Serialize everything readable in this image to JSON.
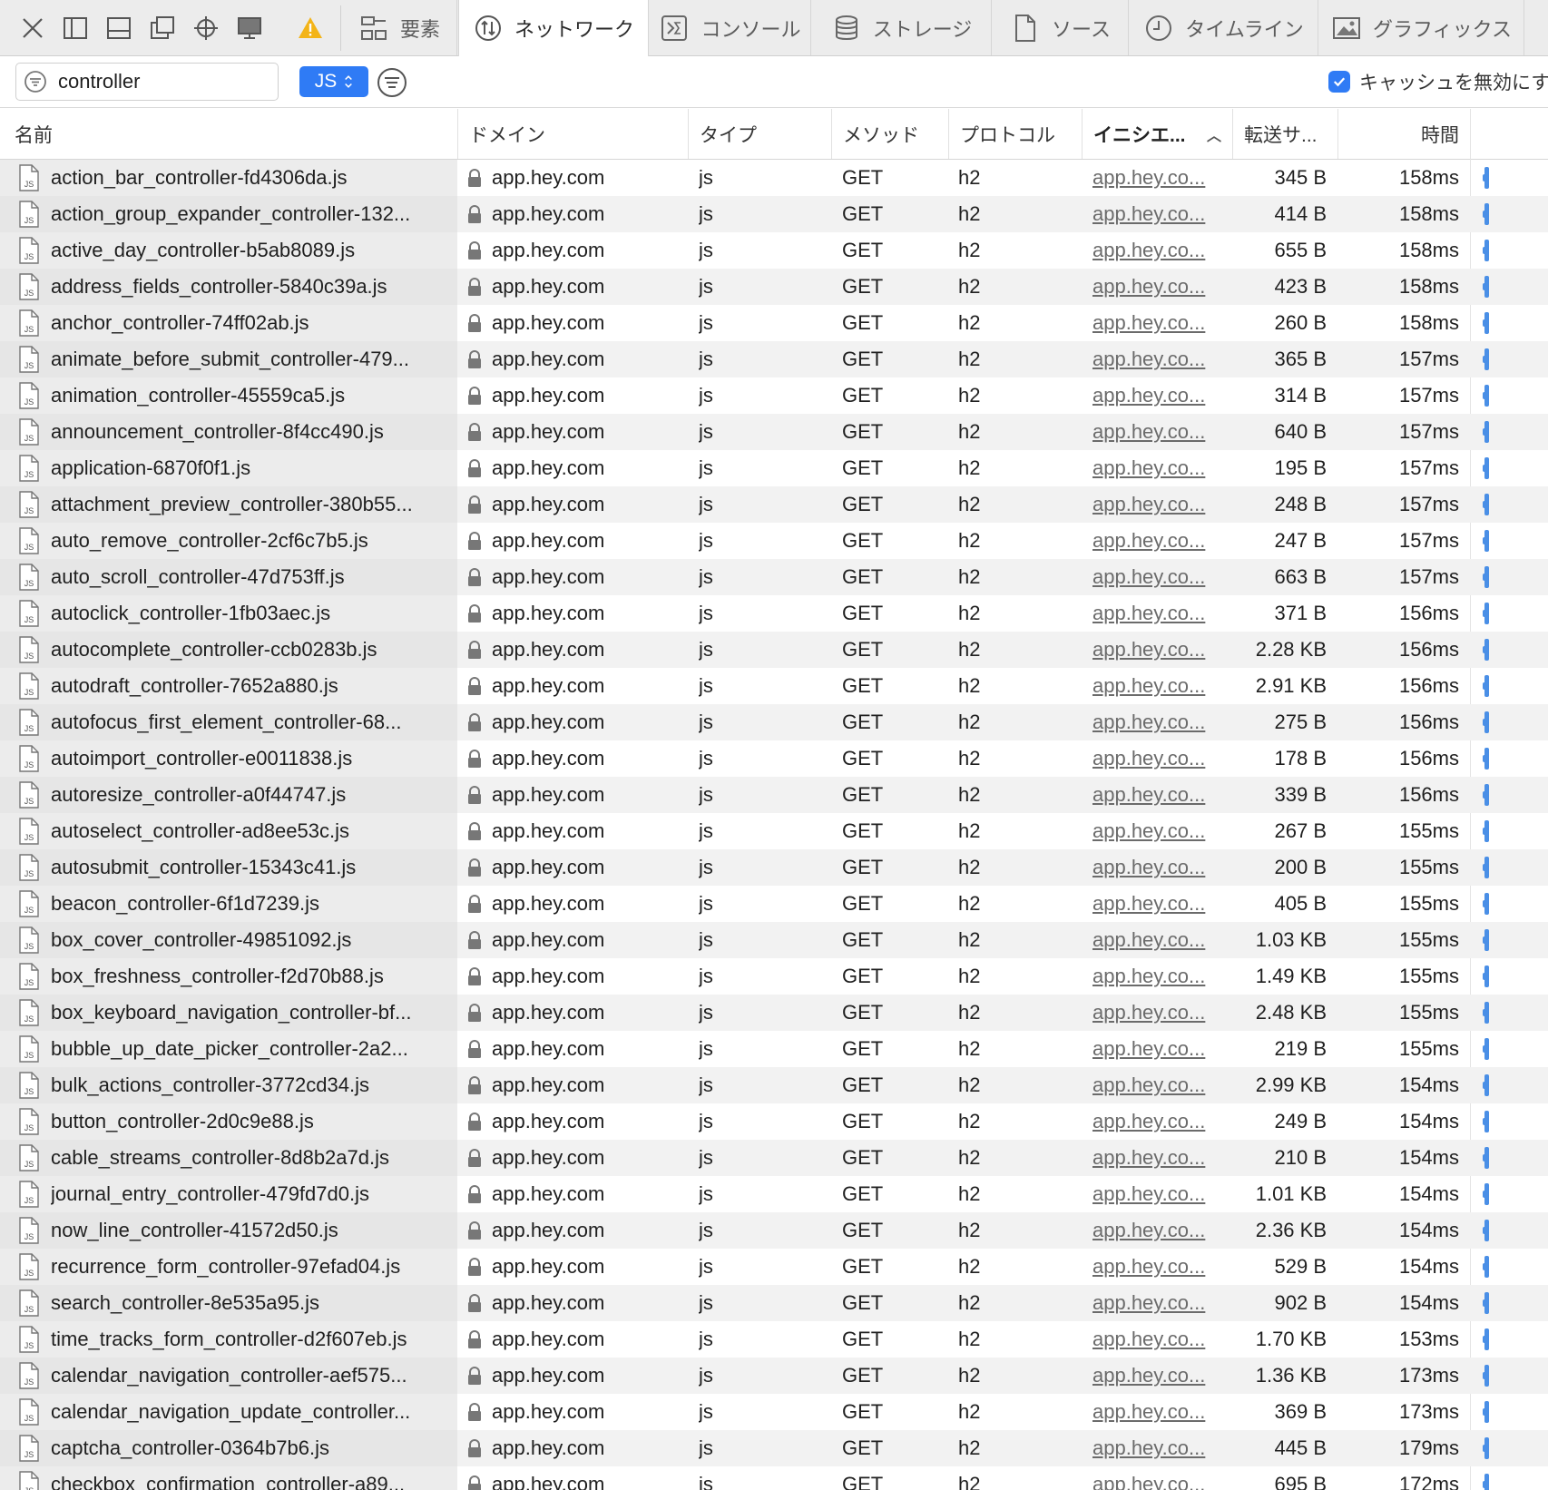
{
  "toolbar": {
    "icons": [
      "close-icon",
      "dock-side-icon",
      "dock-bottom-icon",
      "detach-window-icon",
      "inspect-target-icon",
      "device-icon",
      "warning-icon"
    ],
    "tabs": [
      {
        "label": "要素",
        "icon": "elements-icon"
      },
      {
        "label": "ネットワーク",
        "icon": "network-icon"
      },
      {
        "label": "コンソール",
        "icon": "console-icon"
      },
      {
        "label": "ストレージ",
        "icon": "storage-icon"
      },
      {
        "label": "ソース",
        "icon": "sources-icon"
      },
      {
        "label": "タイムライン",
        "icon": "timeline-icon"
      },
      {
        "label": "グラフィックス",
        "icon": "graphics-icon"
      }
    ],
    "active_tab": "ネットワーク"
  },
  "filter": {
    "search_value": "controller",
    "type_filter": "JS",
    "disable_cache_label": "キャッシュを無効にす",
    "disable_cache_checked": true
  },
  "columns": {
    "name": "名前",
    "domain": "ドメイン",
    "type": "タイプ",
    "method": "メソッド",
    "protocol": "プロトコル",
    "initiator": "イニシエ...",
    "size": "転送サ...",
    "time": "時間"
  },
  "colors": {
    "accent": "#2f7bf5",
    "waterfall": "#4a8fe6"
  },
  "rows": [
    {
      "name": "action_bar_controller-fd4306da.js",
      "domain": "app.hey.com",
      "type": "js",
      "method": "GET",
      "protocol": "h2",
      "initiator": "app.hey.co...",
      "size": "345 B",
      "time": "158ms"
    },
    {
      "name": "action_group_expander_controller-132...",
      "domain": "app.hey.com",
      "type": "js",
      "method": "GET",
      "protocol": "h2",
      "initiator": "app.hey.co...",
      "size": "414 B",
      "time": "158ms"
    },
    {
      "name": "active_day_controller-b5ab8089.js",
      "domain": "app.hey.com",
      "type": "js",
      "method": "GET",
      "protocol": "h2",
      "initiator": "app.hey.co...",
      "size": "655 B",
      "time": "158ms"
    },
    {
      "name": "address_fields_controller-5840c39a.js",
      "domain": "app.hey.com",
      "type": "js",
      "method": "GET",
      "protocol": "h2",
      "initiator": "app.hey.co...",
      "size": "423 B",
      "time": "158ms"
    },
    {
      "name": "anchor_controller-74ff02ab.js",
      "domain": "app.hey.com",
      "type": "js",
      "method": "GET",
      "protocol": "h2",
      "initiator": "app.hey.co...",
      "size": "260 B",
      "time": "158ms"
    },
    {
      "name": "animate_before_submit_controller-479...",
      "domain": "app.hey.com",
      "type": "js",
      "method": "GET",
      "protocol": "h2",
      "initiator": "app.hey.co...",
      "size": "365 B",
      "time": "157ms"
    },
    {
      "name": "animation_controller-45559ca5.js",
      "domain": "app.hey.com",
      "type": "js",
      "method": "GET",
      "protocol": "h2",
      "initiator": "app.hey.co...",
      "size": "314 B",
      "time": "157ms"
    },
    {
      "name": "announcement_controller-8f4cc490.js",
      "domain": "app.hey.com",
      "type": "js",
      "method": "GET",
      "protocol": "h2",
      "initiator": "app.hey.co...",
      "size": "640 B",
      "time": "157ms"
    },
    {
      "name": "application-6870f0f1.js",
      "domain": "app.hey.com",
      "type": "js",
      "method": "GET",
      "protocol": "h2",
      "initiator": "app.hey.co...",
      "size": "195 B",
      "time": "157ms"
    },
    {
      "name": "attachment_preview_controller-380b55...",
      "domain": "app.hey.com",
      "type": "js",
      "method": "GET",
      "protocol": "h2",
      "initiator": "app.hey.co...",
      "size": "248 B",
      "time": "157ms"
    },
    {
      "name": "auto_remove_controller-2cf6c7b5.js",
      "domain": "app.hey.com",
      "type": "js",
      "method": "GET",
      "protocol": "h2",
      "initiator": "app.hey.co...",
      "size": "247 B",
      "time": "157ms"
    },
    {
      "name": "auto_scroll_controller-47d753ff.js",
      "domain": "app.hey.com",
      "type": "js",
      "method": "GET",
      "protocol": "h2",
      "initiator": "app.hey.co...",
      "size": "663 B",
      "time": "157ms"
    },
    {
      "name": "autoclick_controller-1fb03aec.js",
      "domain": "app.hey.com",
      "type": "js",
      "method": "GET",
      "protocol": "h2",
      "initiator": "app.hey.co...",
      "size": "371 B",
      "time": "156ms"
    },
    {
      "name": "autocomplete_controller-ccb0283b.js",
      "domain": "app.hey.com",
      "type": "js",
      "method": "GET",
      "protocol": "h2",
      "initiator": "app.hey.co...",
      "size": "2.28 KB",
      "time": "156ms"
    },
    {
      "name": "autodraft_controller-7652a880.js",
      "domain": "app.hey.com",
      "type": "js",
      "method": "GET",
      "protocol": "h2",
      "initiator": "app.hey.co...",
      "size": "2.91 KB",
      "time": "156ms"
    },
    {
      "name": "autofocus_first_element_controller-68...",
      "domain": "app.hey.com",
      "type": "js",
      "method": "GET",
      "protocol": "h2",
      "initiator": "app.hey.co...",
      "size": "275 B",
      "time": "156ms"
    },
    {
      "name": "autoimport_controller-e0011838.js",
      "domain": "app.hey.com",
      "type": "js",
      "method": "GET",
      "protocol": "h2",
      "initiator": "app.hey.co...",
      "size": "178 B",
      "time": "156ms"
    },
    {
      "name": "autoresize_controller-a0f44747.js",
      "domain": "app.hey.com",
      "type": "js",
      "method": "GET",
      "protocol": "h2",
      "initiator": "app.hey.co...",
      "size": "339 B",
      "time": "156ms"
    },
    {
      "name": "autoselect_controller-ad8ee53c.js",
      "domain": "app.hey.com",
      "type": "js",
      "method": "GET",
      "protocol": "h2",
      "initiator": "app.hey.co...",
      "size": "267 B",
      "time": "155ms"
    },
    {
      "name": "autosubmit_controller-15343c41.js",
      "domain": "app.hey.com",
      "type": "js",
      "method": "GET",
      "protocol": "h2",
      "initiator": "app.hey.co...",
      "size": "200 B",
      "time": "155ms"
    },
    {
      "name": "beacon_controller-6f1d7239.js",
      "domain": "app.hey.com",
      "type": "js",
      "method": "GET",
      "protocol": "h2",
      "initiator": "app.hey.co...",
      "size": "405 B",
      "time": "155ms"
    },
    {
      "name": "box_cover_controller-49851092.js",
      "domain": "app.hey.com",
      "type": "js",
      "method": "GET",
      "protocol": "h2",
      "initiator": "app.hey.co...",
      "size": "1.03 KB",
      "time": "155ms"
    },
    {
      "name": "box_freshness_controller-f2d70b88.js",
      "domain": "app.hey.com",
      "type": "js",
      "method": "GET",
      "protocol": "h2",
      "initiator": "app.hey.co...",
      "size": "1.49 KB",
      "time": "155ms"
    },
    {
      "name": "box_keyboard_navigation_controller-bf...",
      "domain": "app.hey.com",
      "type": "js",
      "method": "GET",
      "protocol": "h2",
      "initiator": "app.hey.co...",
      "size": "2.48 KB",
      "time": "155ms"
    },
    {
      "name": "bubble_up_date_picker_controller-2a2...",
      "domain": "app.hey.com",
      "type": "js",
      "method": "GET",
      "protocol": "h2",
      "initiator": "app.hey.co...",
      "size": "219 B",
      "time": "155ms"
    },
    {
      "name": "bulk_actions_controller-3772cd34.js",
      "domain": "app.hey.com",
      "type": "js",
      "method": "GET",
      "protocol": "h2",
      "initiator": "app.hey.co...",
      "size": "2.99 KB",
      "time": "154ms"
    },
    {
      "name": "button_controller-2d0c9e88.js",
      "domain": "app.hey.com",
      "type": "js",
      "method": "GET",
      "protocol": "h2",
      "initiator": "app.hey.co...",
      "size": "249 B",
      "time": "154ms"
    },
    {
      "name": "cable_streams_controller-8d8b2a7d.js",
      "domain": "app.hey.com",
      "type": "js",
      "method": "GET",
      "protocol": "h2",
      "initiator": "app.hey.co...",
      "size": "210 B",
      "time": "154ms"
    },
    {
      "name": "journal_entry_controller-479fd7d0.js",
      "domain": "app.hey.com",
      "type": "js",
      "method": "GET",
      "protocol": "h2",
      "initiator": "app.hey.co...",
      "size": "1.01 KB",
      "time": "154ms"
    },
    {
      "name": "now_line_controller-41572d50.js",
      "domain": "app.hey.com",
      "type": "js",
      "method": "GET",
      "protocol": "h2",
      "initiator": "app.hey.co...",
      "size": "2.36 KB",
      "time": "154ms"
    },
    {
      "name": "recurrence_form_controller-97efad04.js",
      "domain": "app.hey.com",
      "type": "js",
      "method": "GET",
      "protocol": "h2",
      "initiator": "app.hey.co...",
      "size": "529 B",
      "time": "154ms"
    },
    {
      "name": "search_controller-8e535a95.js",
      "domain": "app.hey.com",
      "type": "js",
      "method": "GET",
      "protocol": "h2",
      "initiator": "app.hey.co...",
      "size": "902 B",
      "time": "154ms"
    },
    {
      "name": "time_tracks_form_controller-d2f607eb.js",
      "domain": "app.hey.com",
      "type": "js",
      "method": "GET",
      "protocol": "h2",
      "initiator": "app.hey.co...",
      "size": "1.70 KB",
      "time": "153ms"
    },
    {
      "name": "calendar_navigation_controller-aef575...",
      "domain": "app.hey.com",
      "type": "js",
      "method": "GET",
      "protocol": "h2",
      "initiator": "app.hey.co...",
      "size": "1.36 KB",
      "time": "173ms"
    },
    {
      "name": "calendar_navigation_update_controller...",
      "domain": "app.hey.com",
      "type": "js",
      "method": "GET",
      "protocol": "h2",
      "initiator": "app.hey.co...",
      "size": "369 B",
      "time": "173ms"
    },
    {
      "name": "captcha_controller-0364b7b6.js",
      "domain": "app.hey.com",
      "type": "js",
      "method": "GET",
      "protocol": "h2",
      "initiator": "app.hey.co...",
      "size": "445 B",
      "time": "179ms"
    },
    {
      "name": "checkbox_confirmation_controller-a89...",
      "domain": "app.hey.com",
      "type": "js",
      "method": "GET",
      "protocol": "h2",
      "initiator": "app.hey.co...",
      "size": "695 B",
      "time": "172ms"
    }
  ]
}
